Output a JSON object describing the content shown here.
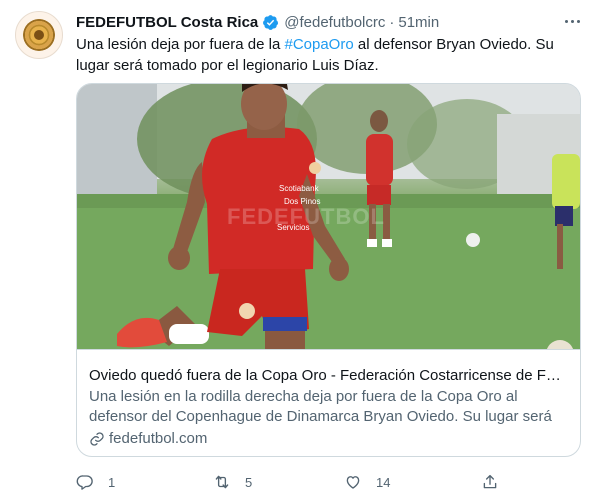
{
  "tweet": {
    "author_name": "FEDEFUTBOL Costa Rica",
    "handle": "@fedefutbolcrc",
    "separator": "·",
    "time": "51min",
    "text_before": "Una lesión deja por fuera de la ",
    "hashtag": "#CopaOro",
    "text_after": " al defensor Bryan Oviedo. Su lugar será tomado por el legionario Luis Díaz."
  },
  "card": {
    "title": "Oviedo quedó fuera de la Copa Oro - Federación Costarricense de Fút...",
    "description": "Una lesión en la rodilla derecha deja por fuera de la Copa Oro al defensor del Copenhague de Dinamarca Bryan Oviedo. Su lugar será ...",
    "domain": "fedefutbol.com",
    "photo_watermark": "FEDEFUTBOL"
  },
  "actions": {
    "reply_count": "1",
    "retweet_count": "5",
    "like_count": "14"
  },
  "icons": {
    "verified": "verified-badge-icon",
    "more": "more-icon",
    "reply": "reply-icon",
    "retweet": "retweet-icon",
    "like": "heart-icon",
    "share": "share-icon",
    "link": "link-icon"
  },
  "colors": {
    "accent": "#1d9bf0",
    "text": "#0f1419",
    "secondary": "#536471",
    "border": "#cfd9de",
    "jersey": "#d12a26"
  }
}
